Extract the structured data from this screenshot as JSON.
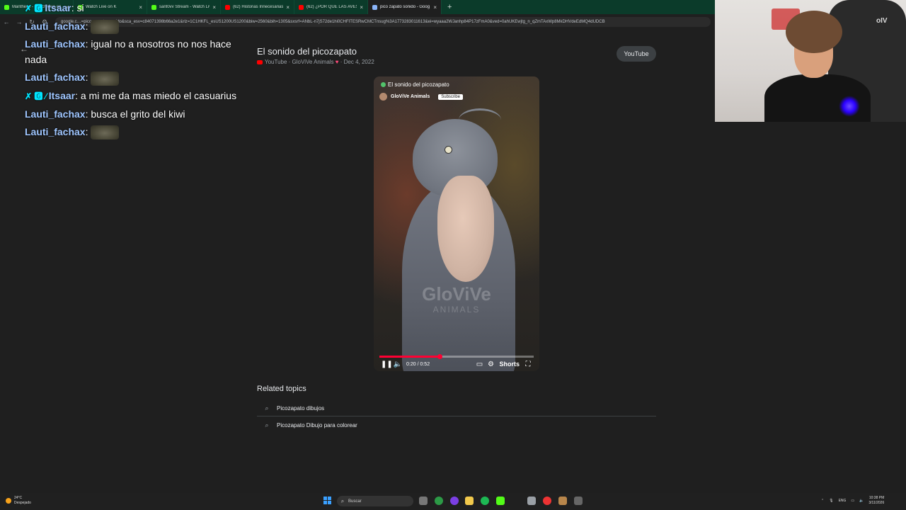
{
  "browser": {
    "tabs": [
      {
        "title": "Mantheus - Watch Live on",
        "color": "#53fc18",
        "active": false
      },
      {
        "title": "Watch Live on K",
        "color": "#53fc18",
        "active": false
      },
      {
        "title": "sant0vv Stream - Watch Live on",
        "color": "#53fc18",
        "active": false
      },
      {
        "title": "(62) Historias Innecesarias De",
        "color": "#ff0000",
        "active": false
      },
      {
        "title": "(62) ¿POR QUE LAS AVES SON",
        "color": "#ff0000",
        "active": false
      },
      {
        "title": "pico zapato sonido - Goog",
        "color": "#8ab4f8",
        "active": true
      }
    ],
    "new_tab": "+",
    "url": "google.c…=pico+zapato+sonido&sca_esv=c84071398b66a2e1&rlz=1C1HKFL_esUS1200US1200&biw=2560&bih=1305&sxsrf=ANbL-n7jS72de1hi0CHFITESRwCMCTnsug%3A1773283011613&ei=wyaaa2WJanhp84P17zFmA0&ved=0ahUKEwjtg_n_qZmTAxWp8MkDHVdeEdMQ4dUDCB"
  },
  "chat": {
    "messages": [
      {
        "user": "Itsaar",
        "text": ": si",
        "badges": "✗ 🅶",
        "emote": false
      },
      {
        "user": "Lauti_fachax",
        "text": ":",
        "badges": "",
        "emote": true
      },
      {
        "user": "Lauti_fachax",
        "text": ": igual no a nosotros no nos hace nada",
        "badges": "",
        "emote": false
      },
      {
        "user": "Lauti_fachax",
        "text": ":",
        "badges": "",
        "emote": true
      },
      {
        "user": "Itsaar",
        "text": ": a mi me da mas miedo el casuarius",
        "badges": "✗ 🅶 ⁄",
        "emote": false
      },
      {
        "user": "Lauti_fachax",
        "text": ": busca el grito del kiwi",
        "badges": "",
        "emote": false
      },
      {
        "user": "Lauti_fachax",
        "text": ":",
        "badges": "",
        "emote": true
      }
    ]
  },
  "result": {
    "title": "El sonido del picozapato",
    "source": "YouTube",
    "channel": "GloViVe Animals",
    "date": "Dec 4, 2022",
    "source_button": "YouTube"
  },
  "video": {
    "title": "El sonido del picozapato",
    "channel": "GloViVe Animals",
    "subscribe": "Subscribe",
    "watermark_main": "GloViVe",
    "watermark_sub": "ANIMALS",
    "time": "0:20 / 0:52",
    "progress": 0.39,
    "shorts_label": "Shorts"
  },
  "related": {
    "heading": "Related topics",
    "items": [
      "Picozapato dibujos",
      "Picozapato Dibujo para colorear"
    ]
  },
  "taskbar": {
    "weather_temp": "24°C",
    "weather_desc": "Despejado",
    "search_placeholder": "Buscar",
    "lang": "ENG",
    "time": "10:38 PM",
    "date": "3/11/2026"
  },
  "webcam": {
    "logo": "oIV"
  }
}
